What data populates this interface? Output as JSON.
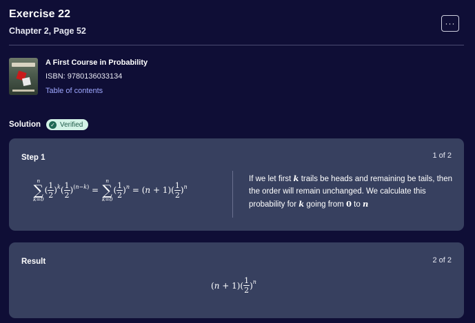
{
  "header": {
    "title": "Exercise 22",
    "subtitle": "Chapter 2, Page 52",
    "more_label": "···"
  },
  "book": {
    "title": "A First Course in Probability",
    "isbn": "ISBN: 9780136033134",
    "toc_label": "Table of contents",
    "cover_icon": "book-cover-image"
  },
  "solution": {
    "label": "Solution",
    "badge": "Verified",
    "badge_icon": "check-circle-icon"
  },
  "step1": {
    "label": "Step 1",
    "counter": "1 of 2",
    "explanation_parts": [
      "If we let first ",
      "k",
      " trails be heads and remaining be tails, then the order will remain unchanged. We calculate this probability for ",
      "k",
      " going from ",
      "0",
      " to ",
      "n"
    ]
  },
  "result": {
    "label": "Result",
    "counter": "2 of 2"
  },
  "colors": {
    "background": "#0f0e36",
    "card": "#37405f",
    "link": "#9fa8ff",
    "badge_bg": "#d3f3e7",
    "badge_text": "#1d5a48"
  }
}
